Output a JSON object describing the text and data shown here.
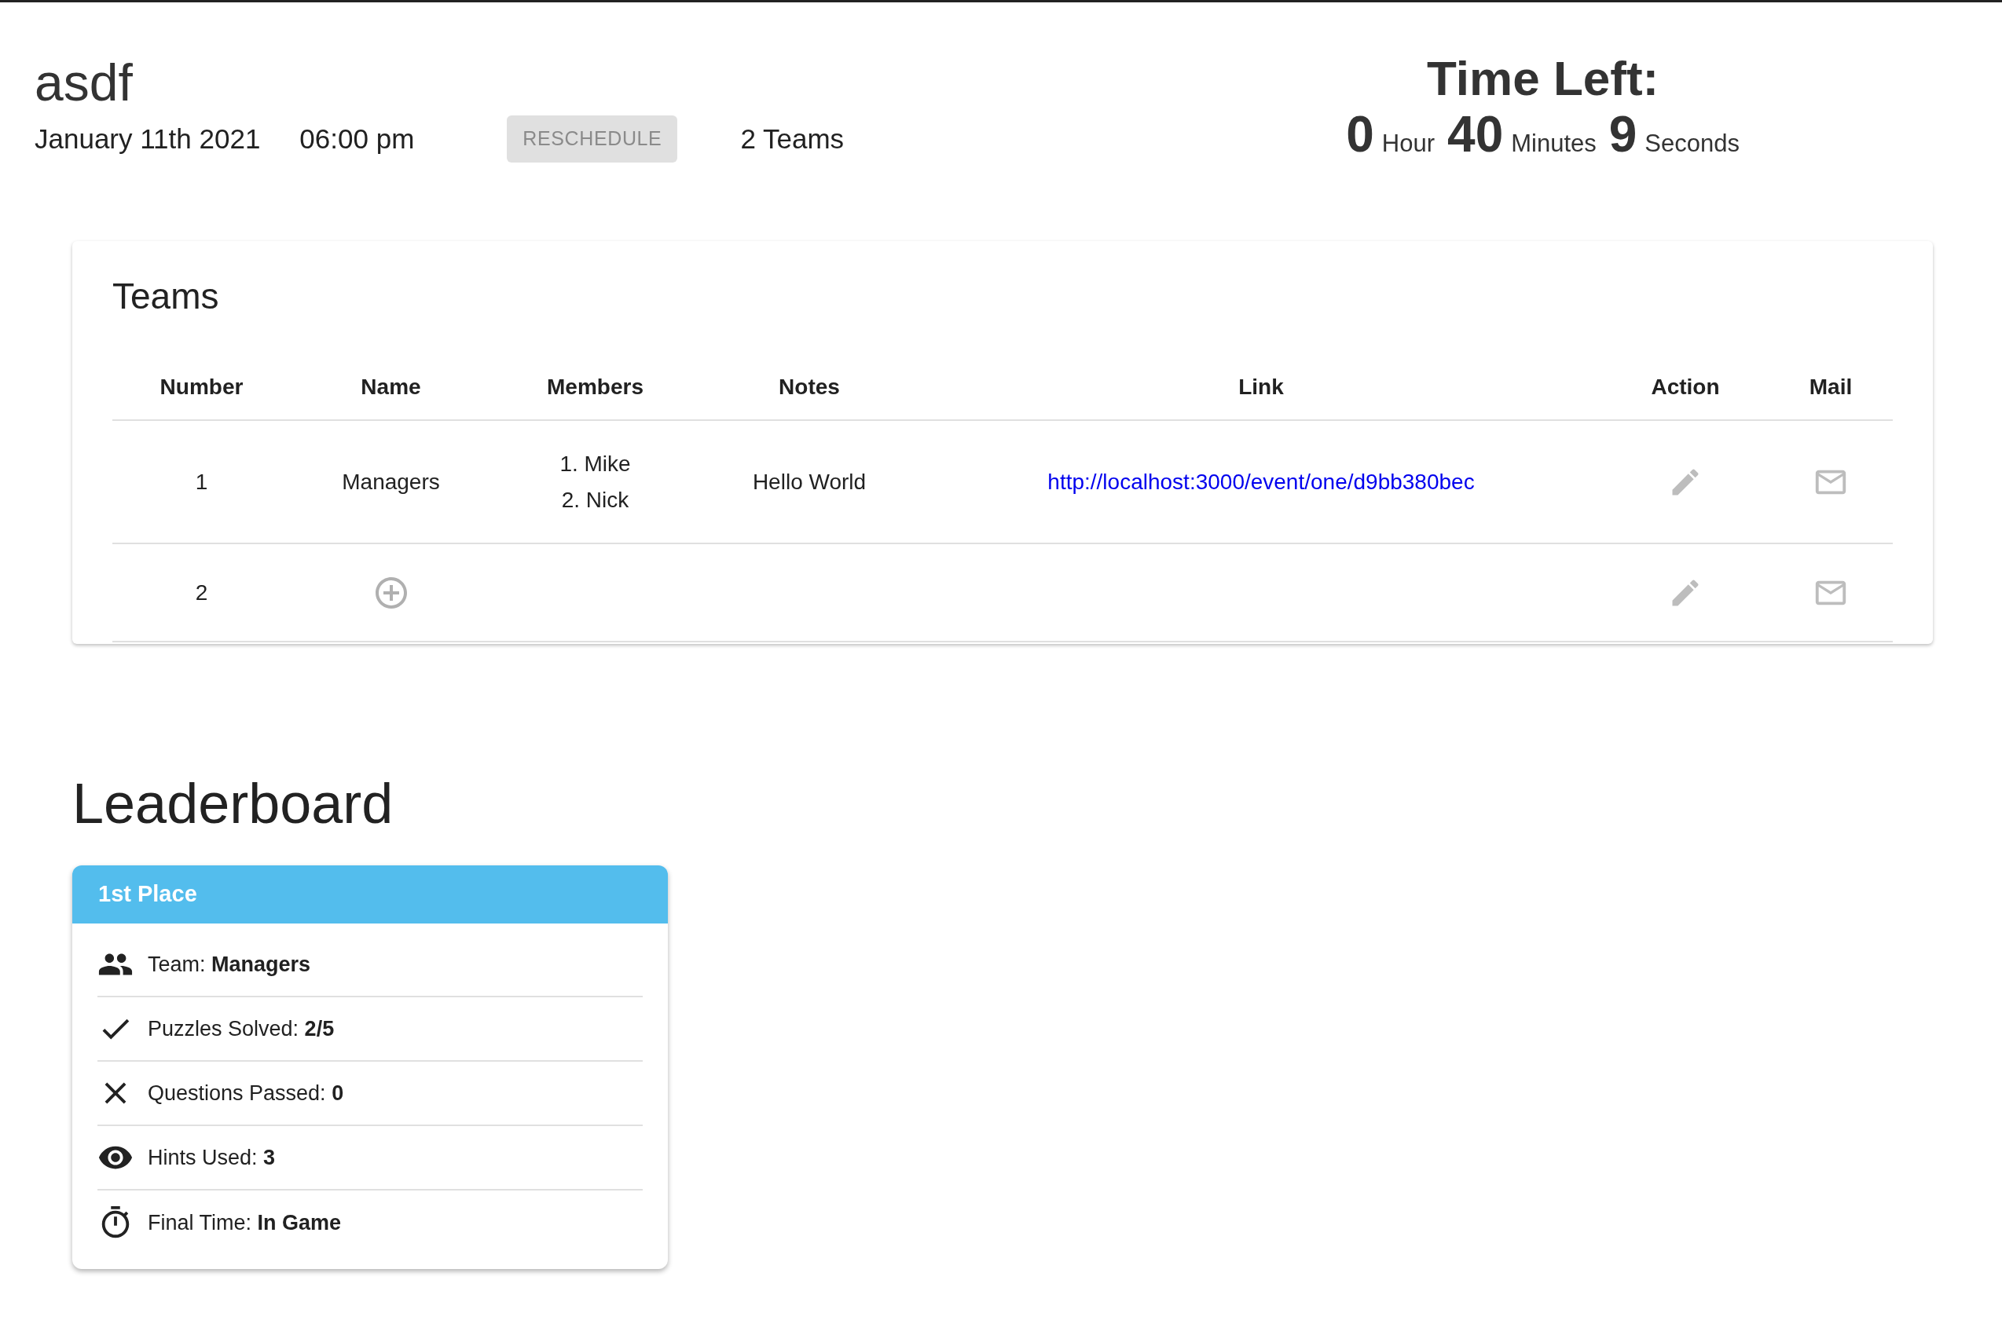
{
  "event": {
    "title": "asdf",
    "date": "January 11th 2021",
    "time": "06:00 pm",
    "reschedule": {
      "label": "RESCHEDULE",
      "disabled": true
    },
    "team_count": "2 Teams"
  },
  "timer": {
    "title": "Time Left:",
    "parts": [
      {
        "value": "0",
        "unit": "Hour"
      },
      {
        "value": "40",
        "unit": "Minutes"
      },
      {
        "value": "9",
        "unit": "Seconds"
      }
    ]
  },
  "teams": {
    "title": "Teams",
    "columns": [
      "Number",
      "Name",
      "Members",
      "Notes",
      "Link",
      "Action",
      "Mail"
    ],
    "rows": [
      {
        "number": "1",
        "name": "Managers",
        "members": [
          "1. Mike",
          "2. Nick"
        ],
        "notes": "Hello World",
        "link": "http://localhost:3000/event/one/d9bb380bec"
      },
      {
        "number": "2",
        "members": []
      }
    ]
  },
  "leaderboard": {
    "title": "Leaderboard",
    "cards": [
      {
        "place": "1st Place",
        "color": "#53bded",
        "stats": [
          {
            "kind": "team",
            "text": "Team: **Managers**"
          },
          {
            "kind": "solved",
            "text": "Puzzles Solved: **2/5**"
          },
          {
            "kind": "passed",
            "text": "Questions Passed: **0**"
          },
          {
            "kind": "hints",
            "text": "Hints Used: **3**"
          },
          {
            "kind": "time",
            "text": "Final Time: **In Game**"
          }
        ]
      }
    ]
  }
}
